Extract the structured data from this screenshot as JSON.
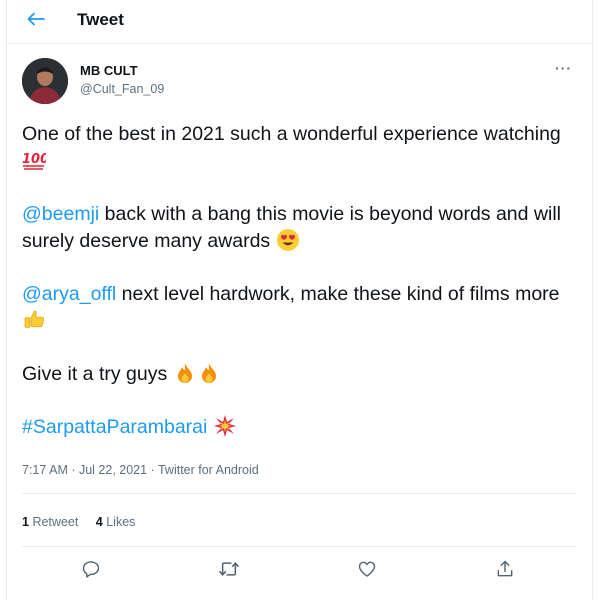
{
  "header": {
    "title": "Tweet",
    "back_icon": "arrow-left-icon",
    "accent": "#1d9bf0"
  },
  "user": {
    "name": "MB CULT",
    "handle": "@Cult_Fan_09",
    "more_icon": "···"
  },
  "tweet": {
    "p1_text": "One of the best in 2021 such a wonderful experience watching ",
    "p1_emoji": "hundred-points-emoji",
    "p2_mention": "@beemji",
    "p2_text": " back with a bang this movie is beyond words and will surely deserve many awards ",
    "p2_emoji": "heart-eyes-emoji",
    "p3_mention": "@arya_offl",
    "p3_text": " next level hardwork, make these kind of films more ",
    "p3_emoji": "thumbs-up-emoji",
    "p4_text": "Give it a try guys ",
    "p4_emoji": "fire-emoji",
    "p5_hashtag": "#SarpattaParambarai",
    "p5_emoji": "collision-emoji"
  },
  "meta": {
    "time": "7:17 AM · Jul 22, 2021 · ",
    "app": "Twitter for Android"
  },
  "stats": {
    "retweets_count": "1",
    "retweets_label": "Retweet",
    "likes_count": "4",
    "likes_label": "Likes"
  },
  "actions": {
    "reply_icon": "reply-icon",
    "retweet_icon": "retweet-icon",
    "like_icon": "heart-icon",
    "share_icon": "share-icon"
  }
}
